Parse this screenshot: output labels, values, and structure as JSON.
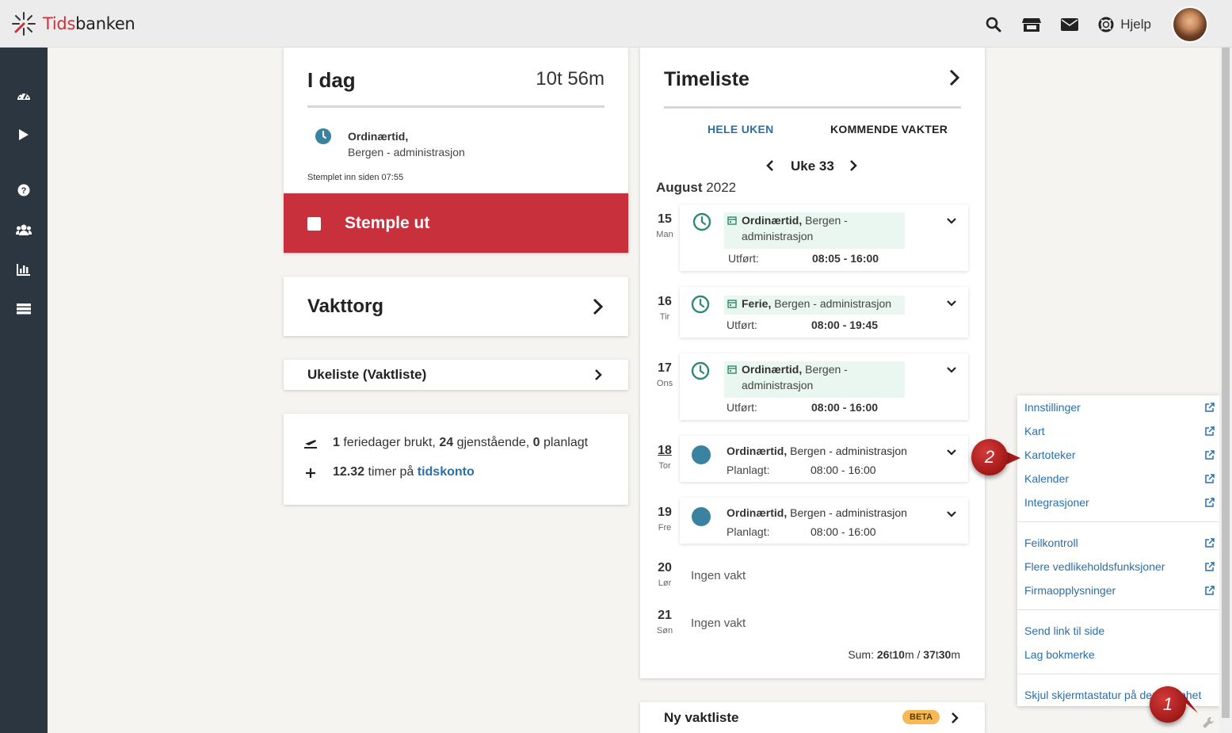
{
  "header": {
    "logo_prefix": "Tids",
    "logo_suffix": "banken",
    "help_label": "Hjelp"
  },
  "sidebar": {
    "items": [
      "dashboard-icon",
      "play-icon",
      "help-icon",
      "users-icon",
      "chart-icon",
      "list-icon"
    ]
  },
  "today": {
    "title": "I dag",
    "time": "10t 56m",
    "category": "Ordinærtid,",
    "department": "Bergen - administrasjon",
    "stamped_in": "Stemplet inn siden 07:55",
    "stamp_out_label": "Stemple ut"
  },
  "vakttorg": {
    "title": "Vakttorg"
  },
  "ukeliste": {
    "title": "Ukeliste (Vaktliste)"
  },
  "vacation": {
    "used": "1",
    "used_text": "feriedager brukt,",
    "remaining": "24",
    "remaining_text": "gjenstående,",
    "planned": "0",
    "planned_text": "planlagt",
    "hours": "12.32",
    "hours_text": "timer på",
    "account_link": "tidskonto"
  },
  "timeliste": {
    "title": "Timeliste",
    "tab_week": "HELE UKEN",
    "tab_upcoming": "KOMMENDE VAKTER",
    "week_label": "Uke 33",
    "month": "August",
    "year": "2022",
    "days": [
      {
        "num": "15",
        "name": "Man",
        "type": "Ordinærtid,",
        "dept": "Bergen -",
        "dept2": "administrasjon",
        "label": "Utført:",
        "time": "08:05 - 16:00"
      },
      {
        "num": "16",
        "name": "Tir",
        "type": "Ferie,",
        "dept": "Bergen - administrasjon",
        "label": "Utført:",
        "time": "08:00 - 19:45"
      },
      {
        "num": "17",
        "name": "Ons",
        "type": "Ordinærtid,",
        "dept": "Bergen -",
        "dept2": "administrasjon",
        "label": "Utført:",
        "time": "08:00 - 16:00"
      },
      {
        "num": "18",
        "name": "Tor",
        "type": "Ordinærtid,",
        "dept": "Bergen - administrasjon",
        "label": "Planlagt:",
        "time": "08:00 - 16:00"
      },
      {
        "num": "19",
        "name": "Fre",
        "type": "Ordinærtid,",
        "dept": "Bergen - administrasjon",
        "label": "Planlagt:",
        "time": "08:00 - 16:00"
      },
      {
        "num": "20",
        "name": "Lør",
        "none": "Ingen vakt"
      },
      {
        "num": "21",
        "name": "Søn",
        "none": "Ingen vakt"
      }
    ],
    "sum_label": "Sum:",
    "sum_h1": "26",
    "sum_t1": "t",
    "sum_m1": "10",
    "sum_u1": "m",
    "sum_sep": "/",
    "sum_h2": "37",
    "sum_t2": "t",
    "sum_m2": "30",
    "sum_u2": "m"
  },
  "ny_vaktliste": {
    "title": "Ny vaktliste",
    "badge": "BETA"
  },
  "menu": {
    "group1": [
      "Innstillinger",
      "Kart",
      "Kartoteker",
      "Kalender",
      "Integrasjoner"
    ],
    "group2": [
      "Feilkontroll",
      "Flere vedlikeholdsfunksjoner",
      "Firmaopplysninger"
    ],
    "group3": [
      "Send link til side",
      "Lag bokmerke"
    ],
    "group4": [
      "Skjul skjermtastatur på denne enhet"
    ]
  },
  "callouts": {
    "one": "1",
    "two": "2"
  },
  "colors": {
    "accent_blue": "#2a6fa8",
    "stamp_red": "#c8313c",
    "sidebar": "#2c3641",
    "teal": "#2e8a6e",
    "planned_dot": "#3b82a0"
  }
}
